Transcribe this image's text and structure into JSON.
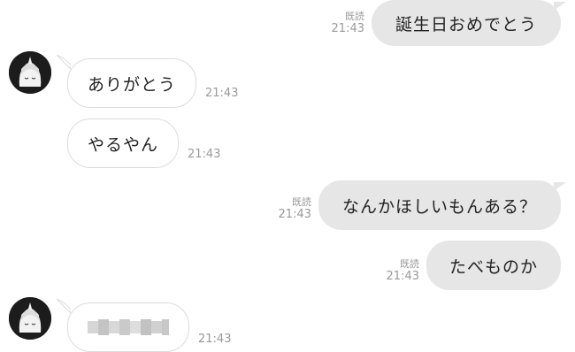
{
  "messages": [
    {
      "side": "out",
      "text": "誕生日おめでとう",
      "read": "既読",
      "time": "21:43"
    },
    {
      "side": "in",
      "text": "ありがとう",
      "time": "21:43"
    },
    {
      "side": "in",
      "text": "やるやん",
      "time": "21:43"
    },
    {
      "side": "out",
      "text": "なんかほしいもんある？",
      "read": "既読",
      "time": "21:43"
    },
    {
      "side": "out",
      "text": "たべものか",
      "read": "既読",
      "time": "21:43"
    },
    {
      "side": "in",
      "text": "",
      "time": "21:43",
      "blurred": true
    }
  ]
}
